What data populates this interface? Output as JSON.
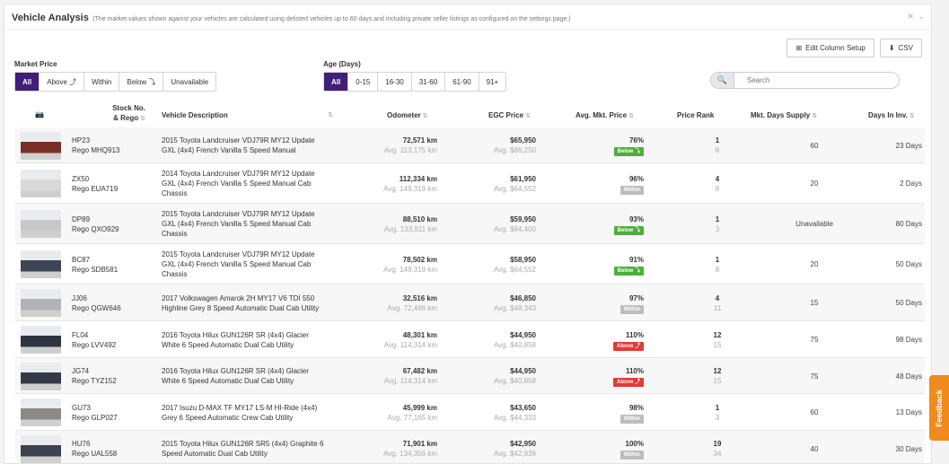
{
  "header": {
    "title": "Vehicle Analysis",
    "subtitle": "(The market values shown against your vehicles are calculated using delisted vehicles up to 60 days and including private seller listings as configured on the settings page.)"
  },
  "toolbar": {
    "edit_columns_label": "Edit Column Setup",
    "csv_label": "CSV"
  },
  "filters": {
    "market_price": {
      "label": "Market Price",
      "options": [
        "All",
        "Above ⤴",
        "Within",
        "Below ⤵",
        "Unavailable"
      ],
      "active": "All"
    },
    "age": {
      "label": "Age (Days)",
      "options": [
        "All",
        "0-15",
        "16-30",
        "31-60",
        "61-90",
        "91+"
      ],
      "active": "All"
    }
  },
  "search": {
    "placeholder": "Search"
  },
  "columns": {
    "photo": "📷",
    "stock": "Stock No.",
    "stock2": "& Rego",
    "description": "Vehicle Description",
    "odometer": "Odometer",
    "egc_price": "EGC Price",
    "avg_mkt_price": "Avg. Mkt. Price",
    "price_rank": "Price Rank",
    "days_supply": "Mkt. Days Supply",
    "days_in_inv": "Days In Inv."
  },
  "colors": {
    "accent": "#3f1f78",
    "below": "#4caf3a",
    "within": "#bdbdbd",
    "above": "#e53935",
    "feedback": "#f08a1c"
  },
  "rows": [
    {
      "stock": "HP23",
      "rego": "Rego MHQ913",
      "desc": [
        "2015 Toyota Landcruiser VDJ79R MY12 Update",
        "GXL (4x4) French Vanilla 5 Speed Manual"
      ],
      "odo": "72,571 km",
      "odo_avg": "Avg. 113,175 km",
      "price": "$65,950",
      "price_avg": "Avg. $86,250",
      "pct": "76%",
      "status": "Below ⤵",
      "status_type": "below",
      "rank": "1",
      "rank_of": "8",
      "supply": "60",
      "days": "23 Days",
      "thumb": "#7a2f26"
    },
    {
      "stock": "ZX50",
      "rego": "Rego EUA719",
      "desc": [
        "2014 Toyota Landcruiser VDJ79R MY12 Update",
        "GXL (4x4) French Vanilla 5 Speed Manual Cab",
        "Chassis"
      ],
      "odo": "112,334 km",
      "odo_avg": "Avg. 149,319 km",
      "price": "$61,950",
      "price_avg": "Avg. $64,552",
      "pct": "96%",
      "status": "Within",
      "status_type": "within",
      "rank": "4",
      "rank_of": "8",
      "supply": "20",
      "days": "2 Days",
      "thumb": "#d9d9d9"
    },
    {
      "stock": "DP89",
      "rego": "Rego QXO929",
      "desc": [
        "2015 Toyota Landcruiser VDJ79R MY12 Update",
        "GXL (4x4) French Vanilla 5 Speed Manual Cab",
        "Chassis"
      ],
      "odo": "88,510 km",
      "odo_avg": "Avg. 133,911 km",
      "price": "$59,950",
      "price_avg": "Avg. $64,400",
      "pct": "93%",
      "status": "Below ⤵",
      "status_type": "below",
      "rank": "1",
      "rank_of": "3",
      "supply": "Unavailable",
      "days": "80 Days",
      "thumb": "#c8c8c8"
    },
    {
      "stock": "BC87",
      "rego": "Rego SDB581",
      "desc": [
        "2015 Toyota Landcruiser VDJ79R MY12 Update",
        "GXL (4x4) French Vanilla 5 Speed Manual Cab",
        "Chassis"
      ],
      "odo": "78,502 km",
      "odo_avg": "Avg. 149,319 km",
      "price": "$58,950",
      "price_avg": "Avg. $64,552",
      "pct": "91%",
      "status": "Below ⤵",
      "status_type": "below",
      "rank": "1",
      "rank_of": "8",
      "supply": "20",
      "days": "50 Days",
      "thumb": "#3b4556"
    },
    {
      "stock": "JJ06",
      "rego": "Rego QGW646",
      "desc": [
        "2017 Volkswagen Amarok 2H MY17 V6 TDI 550",
        "Highline Grey 8 Speed Automatic Dual Cab Utility"
      ],
      "odo": "32,516 km",
      "odo_avg": "Avg. 72,466 km",
      "price": "$46,850",
      "price_avg": "Avg. $48,343",
      "pct": "97%",
      "status": "Within",
      "status_type": "within",
      "rank": "4",
      "rank_of": "11",
      "supply": "15",
      "days": "50 Days",
      "thumb": "#b0b4b8"
    },
    {
      "stock": "FL04",
      "rego": "Rego LVV492",
      "desc": [
        "2016 Toyota Hilux GUN126R SR (4x4) Glacier",
        "White 6 Speed Automatic Dual Cab Utility"
      ],
      "odo": "48,301 km",
      "odo_avg": "Avg. 114,314 km",
      "price": "$44,950",
      "price_avg": "Avg. $40,858",
      "pct": "110%",
      "status": "Above ⤴",
      "status_type": "above",
      "rank": "12",
      "rank_of": "15",
      "supply": "75",
      "days": "98 Days",
      "thumb": "#2e3440"
    },
    {
      "stock": "JG74",
      "rego": "Rego TYZ152",
      "desc": [
        "2016 Toyota Hilux GUN126R SR (4x4) Glacier",
        "White 6 Speed Automatic Dual Cab Utility"
      ],
      "odo": "67,482 km",
      "odo_avg": "Avg. 114,314 km",
      "price": "$44,950",
      "price_avg": "Avg. $40,858",
      "pct": "110%",
      "status": "Above ⤴",
      "status_type": "above",
      "rank": "12",
      "rank_of": "15",
      "supply": "75",
      "days": "48 Days",
      "thumb": "#353b46"
    },
    {
      "stock": "GU73",
      "rego": "Rego GLP027",
      "desc": [
        "2017 Isuzu D-MAX TF MY17 LS-M HI-Ride (4x4)",
        "Grey 6 Speed Automatic Crew Cab Utility"
      ],
      "odo": "45,999 km",
      "odo_avg": "Avg. 77,165 km",
      "price": "$43,650",
      "price_avg": "Avg. $44,333",
      "pct": "98%",
      "status": "Within",
      "status_type": "within",
      "rank": "1",
      "rank_of": "3",
      "supply": "60",
      "days": "13 Days",
      "thumb": "#8d8a85"
    },
    {
      "stock": "HU76",
      "rego": "Rego UAL558",
      "desc": [
        "2015 Toyota Hilux GUN126R SR5 (4x4) Graphite 6",
        "Speed Automatic Dual Cab Utility"
      ],
      "odo": "71,901 km",
      "odo_avg": "Avg. 134,356 km",
      "price": "$42,950",
      "price_avg": "Avg. $42,939",
      "pct": "100%",
      "status": "Within",
      "status_type": "within",
      "rank": "19",
      "rank_of": "34",
      "supply": "40",
      "days": "30 Days",
      "thumb": "#3c4250"
    }
  ],
  "feedback_label": "Feedback"
}
